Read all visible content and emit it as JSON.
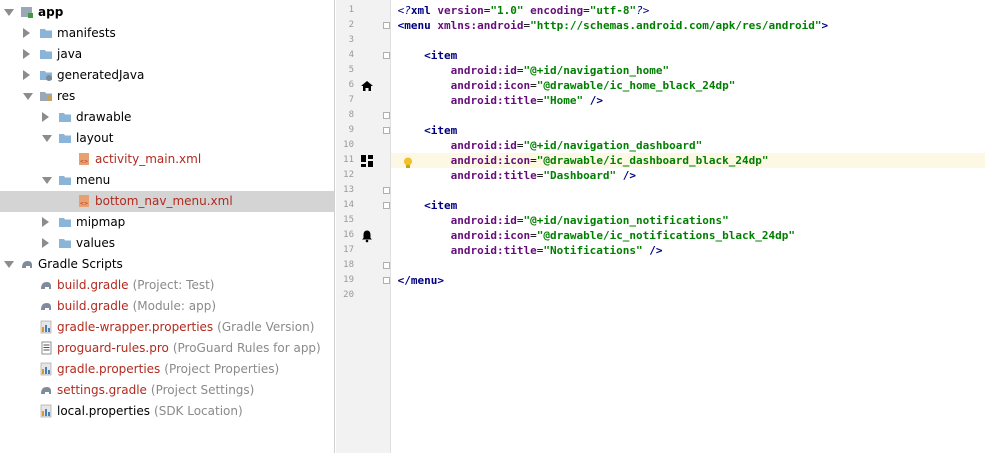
{
  "tree": {
    "items": [
      {
        "label": "app",
        "sub": "",
        "icon": "app-module-icon",
        "arrow": "down",
        "indent": 0,
        "bold": true
      },
      {
        "label": "manifests",
        "sub": "",
        "icon": "folder-icon",
        "arrow": "right",
        "indent": 1
      },
      {
        "label": "java",
        "sub": "",
        "icon": "folder-icon",
        "arrow": "right",
        "indent": 1
      },
      {
        "label": "generatedJava",
        "sub": "",
        "icon": "generated-folder-icon",
        "arrow": "right",
        "indent": 1
      },
      {
        "label": "res",
        "sub": "",
        "icon": "res-folder-icon",
        "arrow": "down",
        "indent": 1
      },
      {
        "label": "drawable",
        "sub": "",
        "icon": "folder-icon",
        "arrow": "right",
        "indent": 2
      },
      {
        "label": "layout",
        "sub": "",
        "icon": "folder-icon",
        "arrow": "down",
        "indent": 2
      },
      {
        "label": "activity_main.xml",
        "sub": "",
        "icon": "xml-file-icon",
        "arrow": "",
        "indent": 3,
        "red": true
      },
      {
        "label": "menu",
        "sub": "",
        "icon": "folder-icon",
        "arrow": "down",
        "indent": 2
      },
      {
        "label": "bottom_nav_menu.xml",
        "sub": "",
        "icon": "xml-file-icon",
        "arrow": "",
        "indent": 3,
        "red": true,
        "selected": true
      },
      {
        "label": "mipmap",
        "sub": "",
        "icon": "folder-icon",
        "arrow": "right",
        "indent": 2
      },
      {
        "label": "values",
        "sub": "",
        "icon": "folder-icon",
        "arrow": "right",
        "indent": 2
      },
      {
        "label": "Gradle Scripts",
        "sub": "",
        "icon": "gradle-elephant-icon",
        "arrow": "down",
        "indent": 0
      },
      {
        "label": "build.gradle",
        "sub": "(Project: Test)",
        "icon": "gradle-file-icon",
        "arrow": "",
        "indent": 1,
        "red": true
      },
      {
        "label": "build.gradle",
        "sub": "(Module: app)",
        "icon": "gradle-file-icon",
        "arrow": "",
        "indent": 1,
        "red": true
      },
      {
        "label": "gradle-wrapper.properties",
        "sub": "(Gradle Version)",
        "icon": "properties-file-icon",
        "arrow": "",
        "indent": 1,
        "red": true
      },
      {
        "label": "proguard-rules.pro",
        "sub": "(ProGuard Rules for app)",
        "icon": "text-file-icon",
        "arrow": "",
        "indent": 1,
        "red": true
      },
      {
        "label": "gradle.properties",
        "sub": "(Project Properties)",
        "icon": "properties-file-icon",
        "arrow": "",
        "indent": 1,
        "red": true
      },
      {
        "label": "settings.gradle",
        "sub": "(Project Settings)",
        "icon": "gradle-file-icon",
        "arrow": "",
        "indent": 1,
        "red": true
      },
      {
        "label": "local.properties",
        "sub": "(SDK Location)",
        "icon": "properties-file-icon",
        "arrow": "",
        "indent": 1
      }
    ]
  },
  "editor": {
    "highlighted_line": 11,
    "line_numbers": [
      "1",
      "2",
      "3",
      "4",
      "5",
      "6",
      "7",
      "8",
      "9",
      "10",
      "11",
      "12",
      "13",
      "14",
      "15",
      "16",
      "17",
      "18",
      "19",
      "20"
    ],
    "gutter_icons": [
      {
        "line": 6,
        "icon": "home-icon"
      },
      {
        "line": 11,
        "icon": "dashboard-icon"
      },
      {
        "line": 16,
        "icon": "bell-icon"
      }
    ],
    "fold_lines": [
      2,
      4,
      8,
      9,
      13,
      14,
      18,
      19
    ],
    "lines": [
      [
        [
          "pi",
          "<?"
        ],
        [
          "tag",
          "xml "
        ],
        [
          "attr",
          "version"
        ],
        [
          "pun",
          "="
        ],
        [
          "str",
          "\"1.0\""
        ],
        [
          "pun",
          " "
        ],
        [
          "attr",
          "encoding"
        ],
        [
          "pun",
          "="
        ],
        [
          "str",
          "\"utf-8\""
        ],
        [
          "pi",
          "?>"
        ]
      ],
      [
        [
          "tag",
          "<menu "
        ],
        [
          "attr",
          "xmlns:android"
        ],
        [
          "pun",
          "="
        ],
        [
          "str",
          "\"http://schemas.android.com/apk/res/android\""
        ],
        [
          "tag",
          ">"
        ]
      ],
      [],
      [
        [
          "pun",
          "    "
        ],
        [
          "tag",
          "<item"
        ]
      ],
      [
        [
          "pun",
          "        "
        ],
        [
          "attr",
          "android:id"
        ],
        [
          "pun",
          "="
        ],
        [
          "str",
          "\"@+id/navigation_home\""
        ]
      ],
      [
        [
          "pun",
          "        "
        ],
        [
          "attr",
          "android:icon"
        ],
        [
          "pun",
          "="
        ],
        [
          "str",
          "\"@drawable/ic_home_black_24dp\""
        ]
      ],
      [
        [
          "pun",
          "        "
        ],
        [
          "attr",
          "android:title"
        ],
        [
          "pun",
          "="
        ],
        [
          "str",
          "\"Home\""
        ],
        [
          "tag",
          " />"
        ]
      ],
      [],
      [
        [
          "pun",
          "    "
        ],
        [
          "tag",
          "<item"
        ]
      ],
      [
        [
          "pun",
          "        "
        ],
        [
          "attr",
          "android:id"
        ],
        [
          "pun",
          "="
        ],
        [
          "str",
          "\"@+id/navigation_dashboard\""
        ]
      ],
      [
        [
          "pun",
          "        "
        ],
        [
          "attr",
          "android:icon"
        ],
        [
          "pun",
          "="
        ],
        [
          "str",
          "\"@drawable/ic_dashboard_black_24dp\""
        ]
      ],
      [
        [
          "pun",
          "        "
        ],
        [
          "attr",
          "android:title"
        ],
        [
          "pun",
          "="
        ],
        [
          "str",
          "\"Dashboard\""
        ],
        [
          "tag",
          " />"
        ]
      ],
      [],
      [
        [
          "pun",
          "    "
        ],
        [
          "tag",
          "<item"
        ]
      ],
      [
        [
          "pun",
          "        "
        ],
        [
          "attr",
          "android:id"
        ],
        [
          "pun",
          "="
        ],
        [
          "str",
          "\"@+id/navigation_notifications\""
        ]
      ],
      [
        [
          "pun",
          "        "
        ],
        [
          "attr",
          "android:icon"
        ],
        [
          "pun",
          "="
        ],
        [
          "str",
          "\"@drawable/ic_notifications_black_24dp\""
        ]
      ],
      [
        [
          "pun",
          "        "
        ],
        [
          "attr",
          "android:title"
        ],
        [
          "pun",
          "="
        ],
        [
          "str",
          "\"Notifications\""
        ],
        [
          "tag",
          " />"
        ]
      ],
      [],
      [
        [
          "tag",
          "</menu>"
        ]
      ],
      []
    ]
  },
  "colors": {
    "selection": "#d4d4d4",
    "highlight_line": "#fcf8e3",
    "folder": "#8ab4d8",
    "xml_red": "#b22a1e"
  }
}
